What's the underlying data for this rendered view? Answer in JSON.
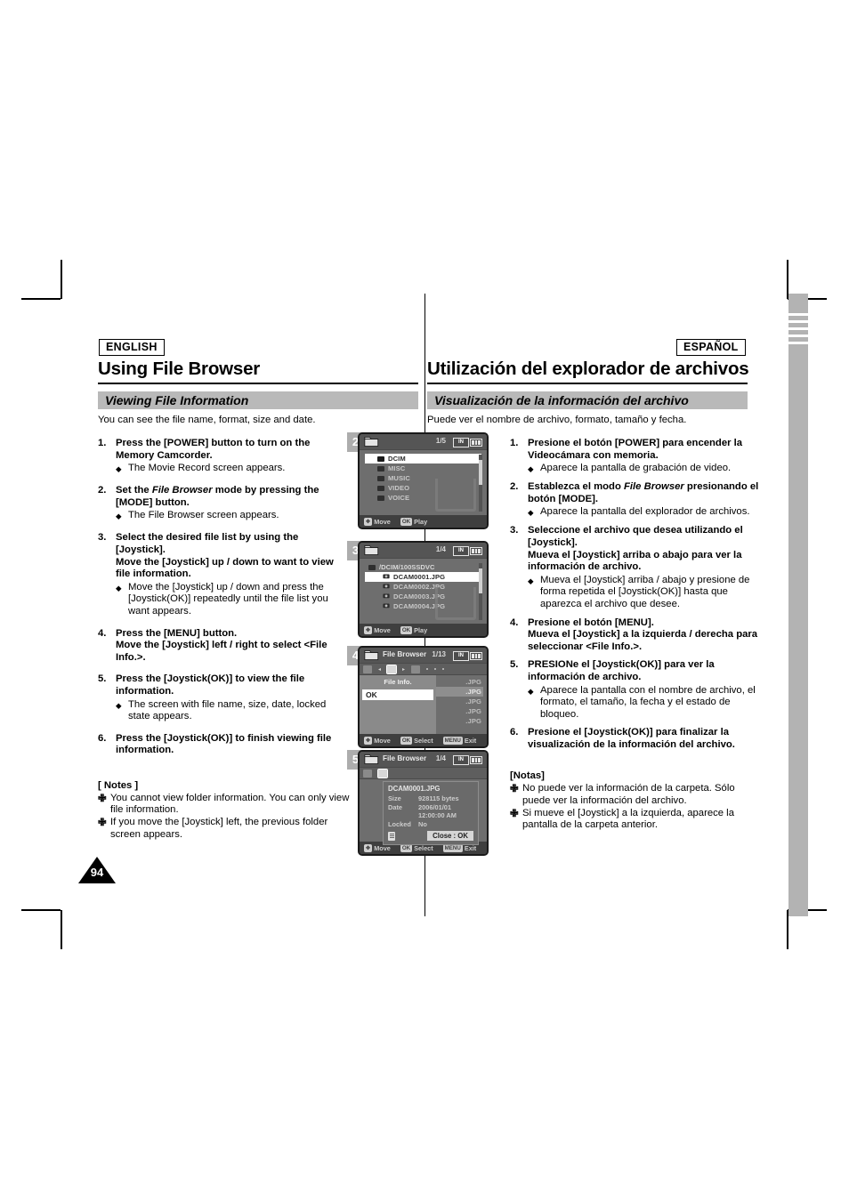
{
  "page": {
    "number": "94"
  },
  "english": {
    "badge": "ENGLISH",
    "chapter": "Using File Browser",
    "section": "Viewing File Information",
    "lead": "You can see the file name, format, size and date.",
    "steps": [
      {
        "num": "1.",
        "main_pre": "Press the [POWER] button to turn on the Memory Camcorder.",
        "main_ital": "",
        "main_post": "",
        "bullets": [
          "The Movie Record screen appears."
        ]
      },
      {
        "num": "2.",
        "main_pre": "Set the ",
        "main_ital": "File Browser",
        "main_post": " mode by pressing the [MODE] button.",
        "bullets": [
          "The File Browser screen appears."
        ]
      },
      {
        "num": "3.",
        "main_pre": "Select the desired file list by using the [Joystick].\nMove the [Joystick] up / down to want to view file information.",
        "main_ital": "",
        "main_post": "",
        "bullets": [
          "Move the [Joystick] up / down and press the [Joystick(OK)] repeatedly until the file list you want appears."
        ]
      },
      {
        "num": "4.",
        "main_pre": "Press the [MENU] button.\nMove the [Joystick] left / right to select <File Info.>.",
        "main_ital": "",
        "main_post": "",
        "bullets": []
      },
      {
        "num": "5.",
        "main_pre": "Press the [Joystick(OK)] to view the file information.",
        "main_ital": "",
        "main_post": "",
        "bullets": [
          "The screen with file name, size, date, locked state appears."
        ]
      },
      {
        "num": "6.",
        "main_pre": "Press the [Joystick(OK)] to finish viewing file information.",
        "main_ital": "",
        "main_post": "",
        "bullets": []
      }
    ],
    "notes_title": "[ Notes ]",
    "notes": [
      "You cannot view folder information. You can only view file information.",
      "If you move the [Joystick] left, the previous folder screen appears."
    ]
  },
  "spanish": {
    "badge": "ESPAÑOL",
    "chapter": "Utilización del explorador de archivos",
    "section": "Visualización de la información del archivo",
    "lead": "Puede ver el nombre de archivo, formato, tamaño y fecha.",
    "steps": [
      {
        "num": "1.",
        "main_pre": "Presione el botón [POWER] para encender la Videocámara con memoria.",
        "main_ital": "",
        "main_post": "",
        "bullets": [
          "Aparece la pantalla de grabación de video."
        ]
      },
      {
        "num": "2.",
        "main_pre": "Establezca el modo ",
        "main_ital": "File Browser",
        "main_post": " presionando el botón [MODE].",
        "bullets": [
          "Aparece la pantalla del explorador de archivos."
        ]
      },
      {
        "num": "3.",
        "main_pre": "Seleccione el archivo que desea utilizando el [Joystick].\nMueva el [Joystick] arriba o abajo para ver la información de archivo.",
        "main_ital": "",
        "main_post": "",
        "bullets": [
          "Mueva el [Joystick] arriba / abajo y presione de forma repetida el [Joystick(OK)] hasta que aparezca el archivo que desee."
        ]
      },
      {
        "num": "4.",
        "main_pre": "Presione el botón [MENU].\nMueva el [Joystick] a la izquierda / derecha para seleccionar <File Info.>.",
        "main_ital": "",
        "main_post": "",
        "bullets": []
      },
      {
        "num": "5.",
        "main_pre": "PRESIONe el [Joystick(OK)] para ver la información de archivo.",
        "main_ital": "",
        "main_post": "",
        "bullets": [
          "Aparece la pantalla con el nombre de archivo, el formato, el tamaño, la fecha y el estado de bloqueo."
        ]
      },
      {
        "num": "6.",
        "main_pre": "Presione el [Joystick(OK)] para finalizar la visualización de la información del archivo.",
        "main_ital": "",
        "main_post": "",
        "bullets": []
      }
    ],
    "notes_title": "[Notas]",
    "notes": [
      "No puede ver la información de la carpeta. Sólo puede ver la información del archivo.",
      "Si mueve el [Joystick] a la izquierda, aparece la pantalla de la carpeta anterior."
    ]
  },
  "screens": [
    {
      "step_label": "2",
      "title": "",
      "page_indicator": "1/5",
      "battery_label": "IN",
      "items": [
        {
          "label": "DCIM",
          "selected": true
        },
        {
          "label": "MISC",
          "selected": false
        },
        {
          "label": "MUSIC",
          "selected": false
        },
        {
          "label": "VIDEO",
          "selected": false
        },
        {
          "label": "VOICE",
          "selected": false
        }
      ],
      "footer": [
        {
          "key": "✥",
          "label": "Move"
        },
        {
          "key": "OK",
          "label": "Play"
        }
      ]
    },
    {
      "step_label": "3",
      "title": "",
      "page_indicator": "1/4",
      "battery_label": "IN",
      "path": "/DCIM/100SSDVC",
      "items": [
        {
          "label": "DCAM0001.JPG",
          "selected": true
        },
        {
          "label": "DCAM0002.JPG",
          "selected": false
        },
        {
          "label": "DCAM0003.JPG",
          "selected": false
        },
        {
          "label": "DCAM0004.JPG",
          "selected": false
        }
      ],
      "footer": [
        {
          "key": "✥",
          "label": "Move"
        },
        {
          "key": "OK",
          "label": "Play"
        }
      ]
    },
    {
      "step_label": "4",
      "title": "File Browser",
      "page_indicator": "1/13",
      "battery_label": "IN",
      "menu_title": "File Info.",
      "menu_item": "OK",
      "bg_items": [
        ".JPG",
        ".JPG",
        ".JPG",
        ".JPG",
        ".JPG"
      ],
      "footer": [
        {
          "key": "✥",
          "label": "Move"
        },
        {
          "key": "OK",
          "label": "Select"
        },
        {
          "key": "MENU",
          "label": "Exit"
        }
      ]
    },
    {
      "step_label": "5",
      "title": "File Browser",
      "page_indicator": "1/4",
      "battery_label": "IN",
      "info": {
        "file_name": "DCAM0001.JPG",
        "rows": [
          {
            "key": "Size",
            "value": "928115 bytes"
          },
          {
            "key": "Date",
            "value": "2006/01/01"
          },
          {
            "key": "",
            "value": "12:00:00 AM"
          },
          {
            "key": "Locked",
            "value": "No"
          }
        ],
        "close_label": "Close : OK"
      },
      "footer": [
        {
          "key": "✥",
          "label": "Move"
        },
        {
          "key": "OK",
          "label": "Select"
        },
        {
          "key": "MENU",
          "label": "Exit"
        }
      ]
    }
  ]
}
